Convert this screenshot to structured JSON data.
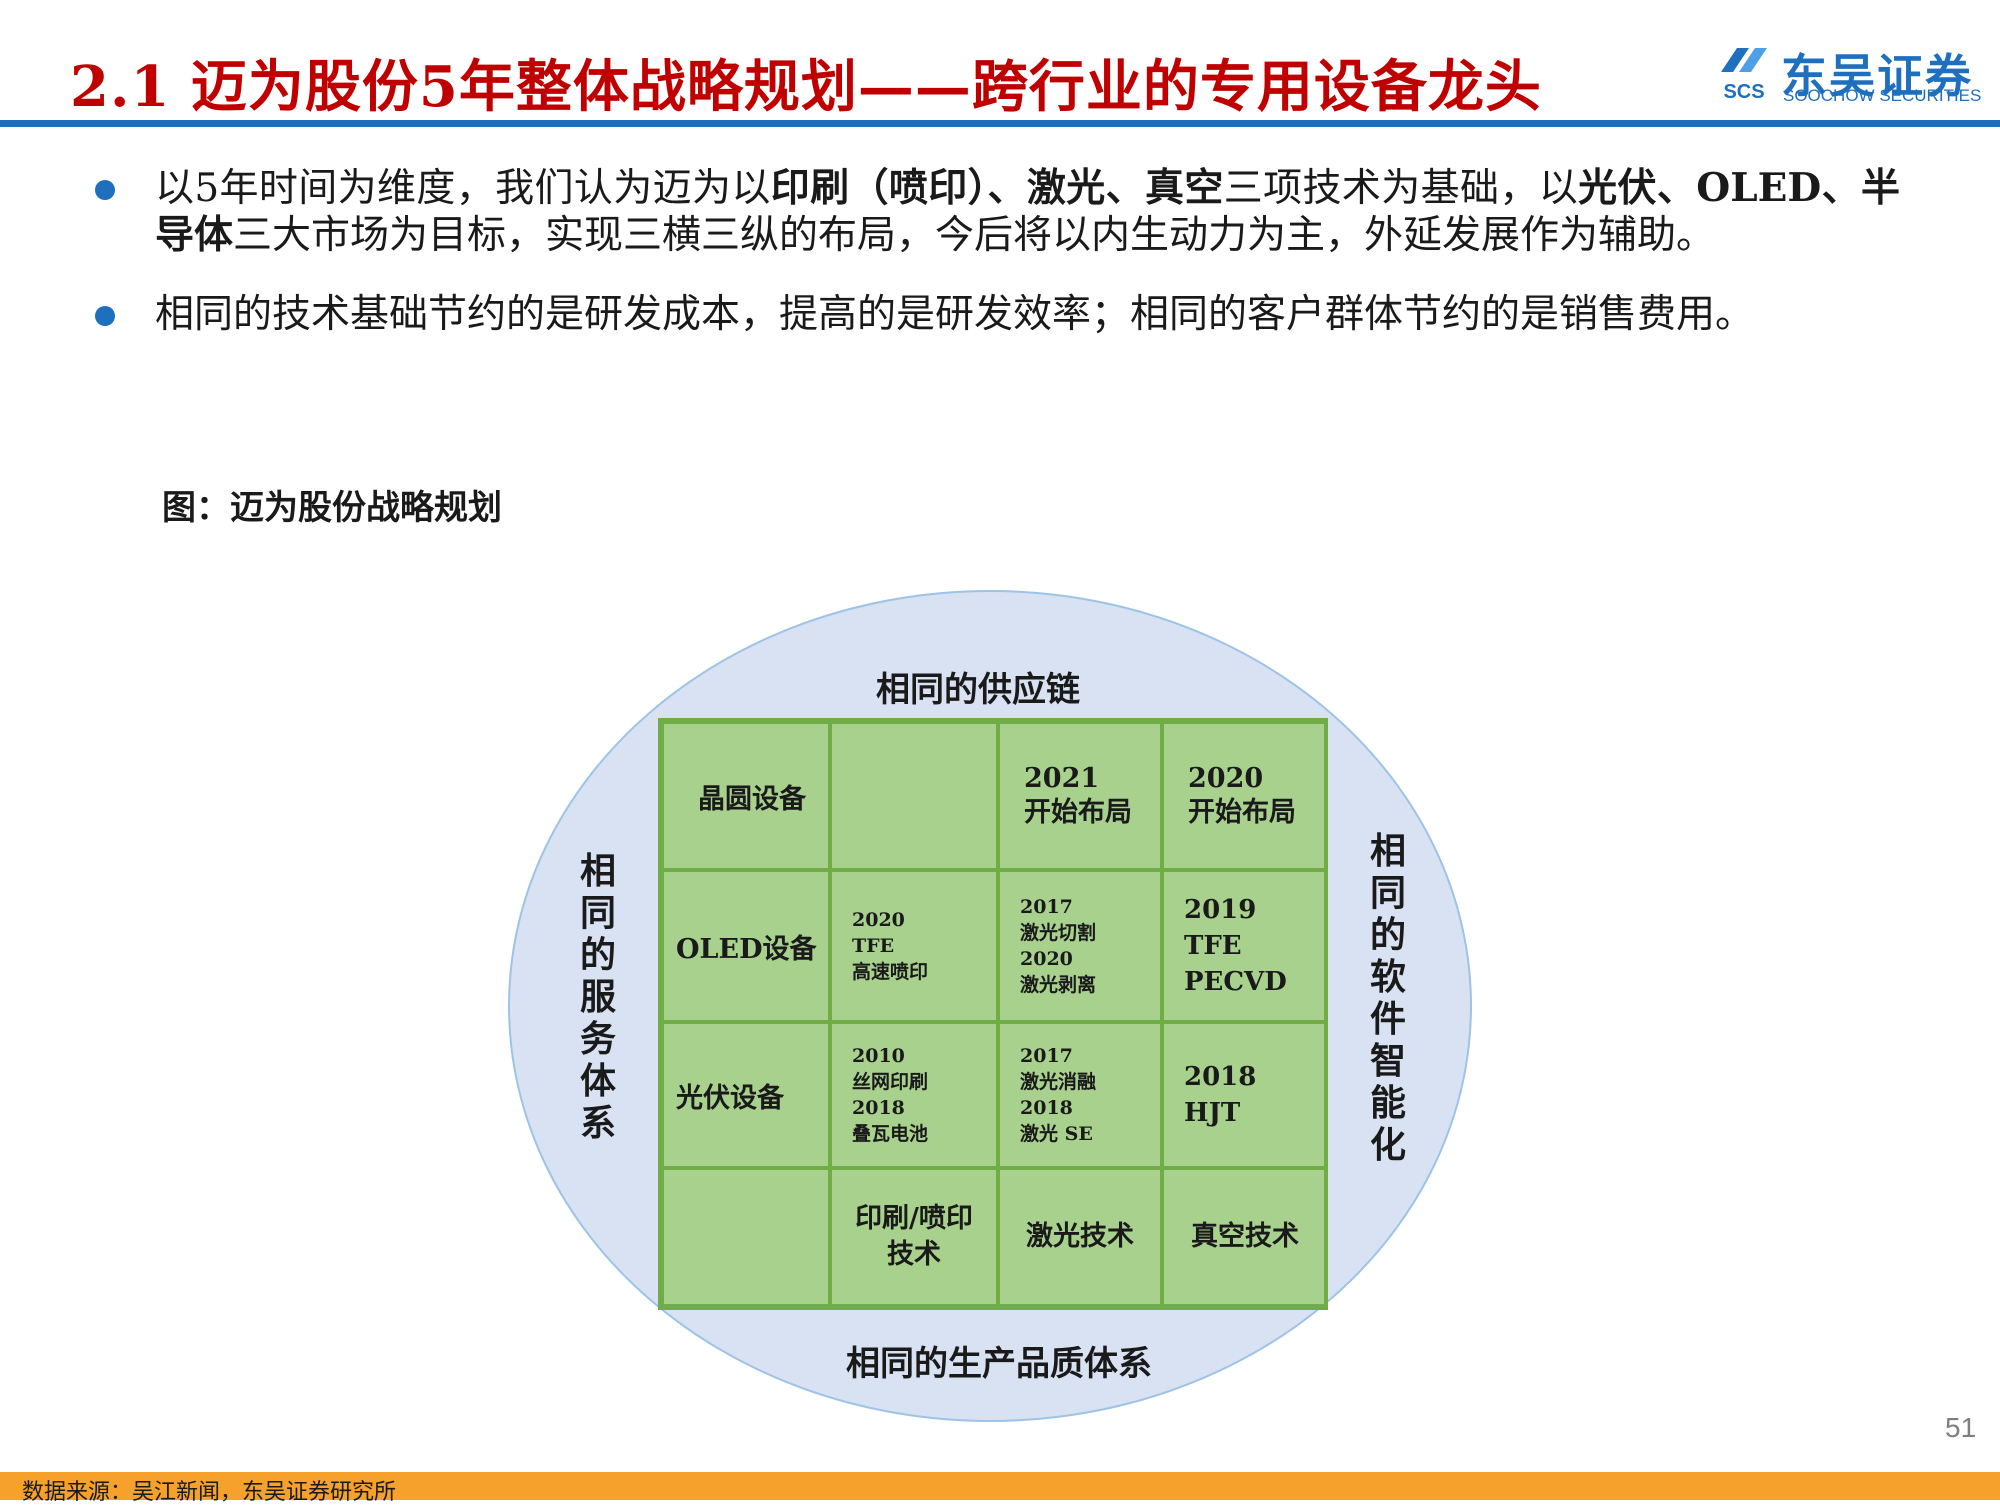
{
  "header": {
    "title": "2.1 迈为股份5年整体战略规划——跨行业的专用设备龙头",
    "logo_cn": "东吴证券",
    "logo_en": "SOOCHOW SECURITIES",
    "logo_mark_text": "SCS"
  },
  "bullets": [
    {
      "parts": [
        {
          "text": "以5年时间为维度，我们认为迈为以",
          "bold": false
        },
        {
          "text": "印刷（喷印）、激光、真空",
          "bold": true
        },
        {
          "text": "三项技术为基础，以",
          "bold": false
        },
        {
          "text": "光伏、OLED、半导体",
          "bold": true
        },
        {
          "text": "三大市场为目标，实现三横三纵的布局，今后将以内生动力为主，外延发展作为辅助。",
          "bold": false
        }
      ]
    },
    {
      "parts": [
        {
          "text": "相同的技术基础节约的是研发成本，提高的是研发效率；相同的客户群体节约的是销售费用。",
          "bold": false
        }
      ]
    }
  ],
  "figure": {
    "caption": "图：迈为股份战略规划",
    "top_label": "相同的供应链",
    "bottom_label": "相同的生产品质体系",
    "left_label": "相同的服务体系",
    "right_label": "相同的软件智能化",
    "rows": [
      {
        "head": "晶圆设备",
        "cells": [
          [],
          [
            "2021",
            "开始布局"
          ],
          [
            "2020",
            "开始布局"
          ]
        ]
      },
      {
        "head": "OLED设备",
        "cells": [
          [
            "2020",
            "TFE",
            "高速喷印"
          ],
          [
            "2017",
            "激光切割",
            "2020",
            "激光剥离"
          ],
          [
            "2019",
            "TFE",
            "PECVD"
          ]
        ]
      },
      {
        "head": "光伏设备",
        "cells": [
          [
            "2010",
            "丝网印刷",
            "2018",
            "叠瓦电池"
          ],
          [
            "2017",
            "激光消融",
            "2018",
            "激光 SE"
          ],
          [
            "2018",
            "HJT"
          ]
        ]
      },
      {
        "head": "",
        "cells": [
          [
            "印刷/喷印",
            "技术"
          ],
          [
            "激光技术"
          ],
          [
            "真空技术"
          ]
        ]
      }
    ]
  },
  "page_number": "51",
  "footer": {
    "source": "数据来源：吴江新闻，东吴证券研究所"
  },
  "colors": {
    "title_red": "#c00000",
    "accent_blue": "#1f6fbf",
    "ellipse_fill": "#d9e2f3",
    "grid_green": "#a9d18e",
    "grid_border": "#70ad47",
    "footer_orange": "#f6a12b"
  }
}
